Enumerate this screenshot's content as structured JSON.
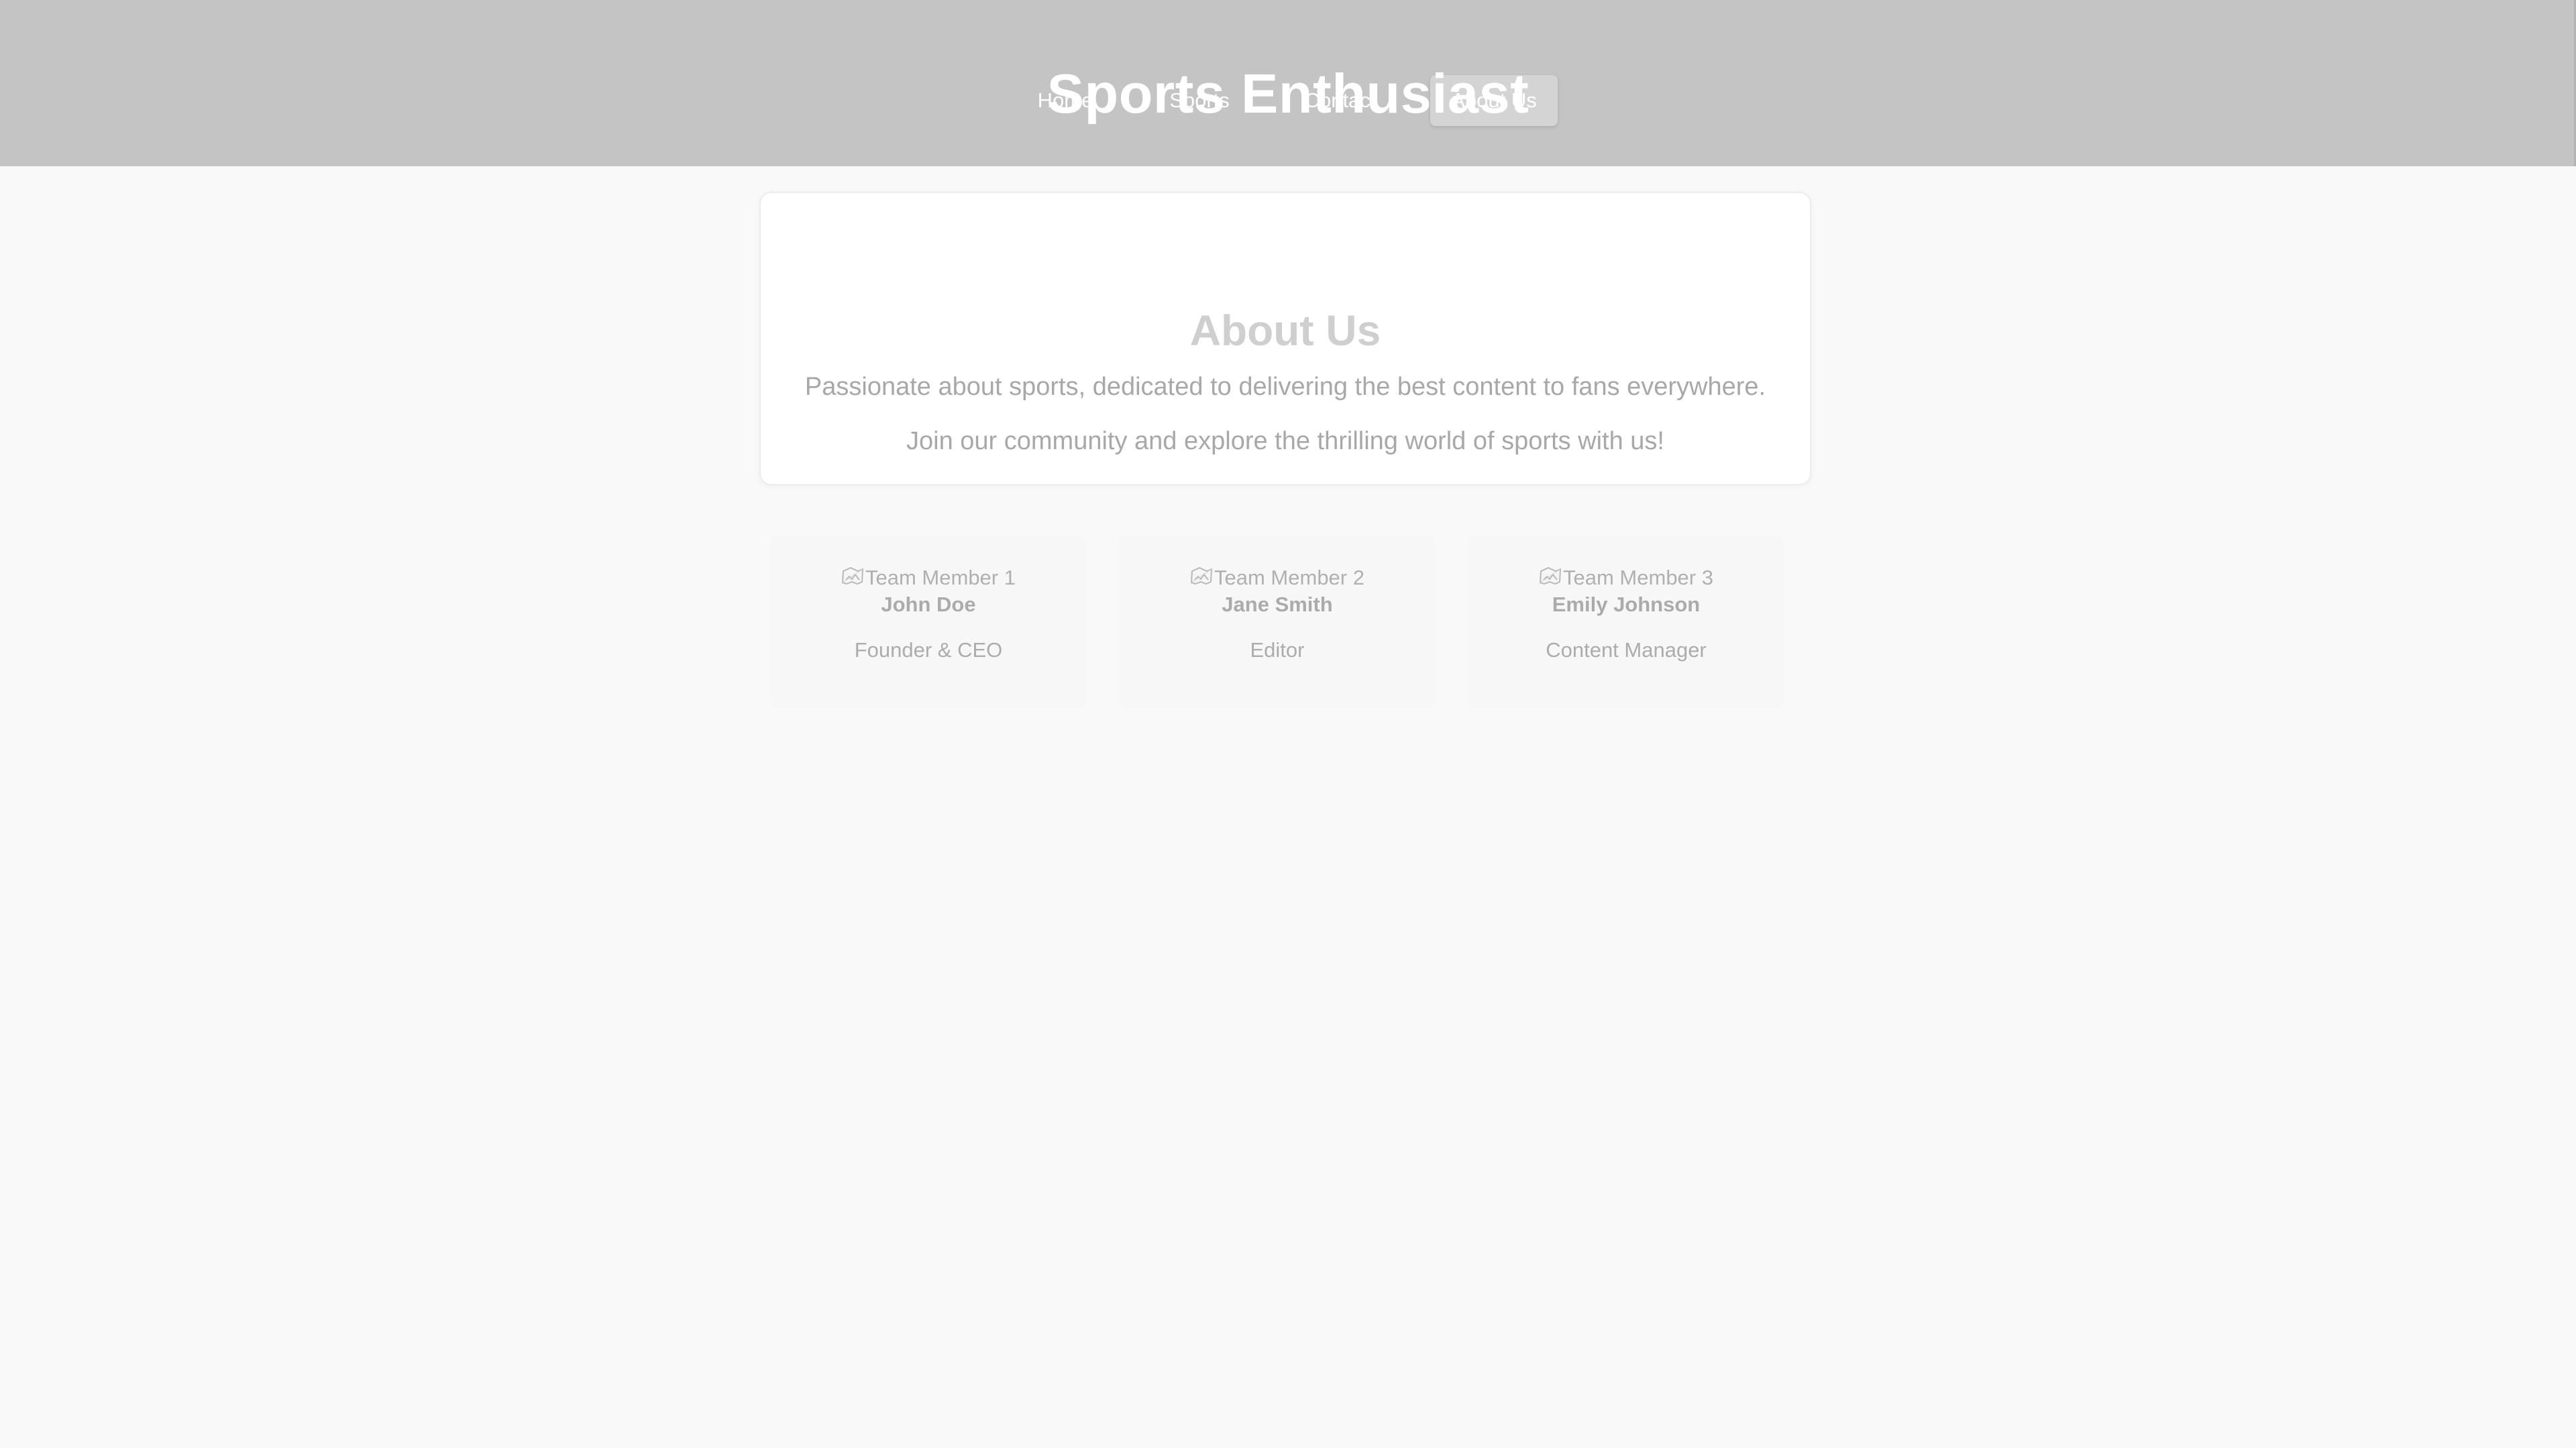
{
  "header": {
    "title": "Sports Enthusiast",
    "nav": [
      {
        "label": "Home"
      },
      {
        "label": "Sports"
      },
      {
        "label": "Contact"
      },
      {
        "label": "About Us",
        "active": true
      }
    ]
  },
  "about": {
    "title": "About Us",
    "paragraphs": [
      "Passionate about sports, dedicated to delivering the best content to fans everywhere.",
      "Join our community and explore the thrilling world of sports with us!"
    ]
  },
  "team": [
    {
      "image_alt": "Team Member 1",
      "name": "John Doe",
      "role": "Founder & CEO"
    },
    {
      "image_alt": "Team Member 2",
      "name": "Jane Smith",
      "role": "Editor"
    },
    {
      "image_alt": "Team Member 3",
      "name": "Emily Johnson",
      "role": "Content Manager"
    }
  ],
  "icons": {
    "team_photo": "broken-image-icon"
  },
  "colors": {
    "header_background": "#c4c4c4",
    "page_background": "#f9f9f9",
    "header_text": "#ffffff",
    "about_title": "#cfcfcf",
    "muted_text": "#a8a8a8"
  }
}
